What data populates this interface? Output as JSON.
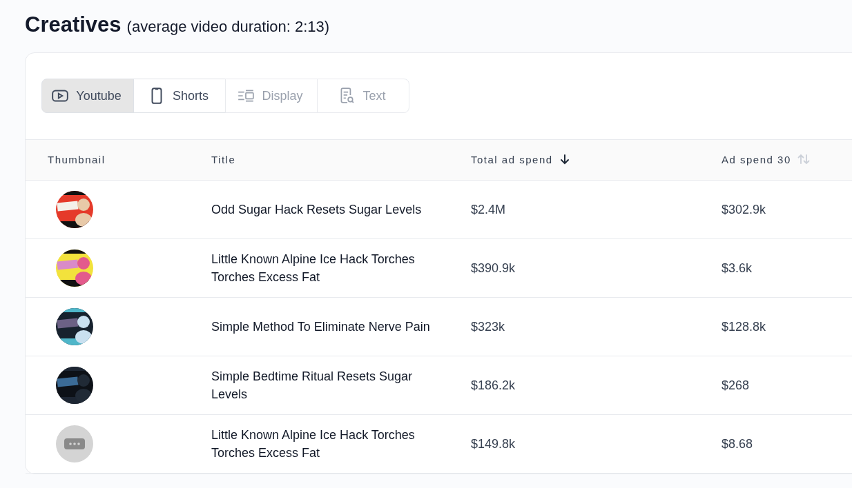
{
  "heading": {
    "title": "Creatives",
    "subtitle": "(average video duration: 2:13)"
  },
  "tabs": [
    {
      "label": "Youtube",
      "kind": "video",
      "selected": true,
      "disabled": false
    },
    {
      "label": "Shorts",
      "kind": "phone",
      "selected": false,
      "disabled": false
    },
    {
      "label": "Display",
      "kind": "display",
      "selected": false,
      "disabled": true
    },
    {
      "label": "Text",
      "kind": "text",
      "selected": false,
      "disabled": true
    }
  ],
  "table": {
    "columns": [
      {
        "label": "Thumbnail",
        "kind": "plain"
      },
      {
        "label": "Title",
        "kind": "plain"
      },
      {
        "label": "Total ad spend",
        "kind": "sorted"
      },
      {
        "label": "Ad spend 30",
        "kind": "sortable"
      }
    ],
    "rows": [
      {
        "title": "Odd Sugar Hack Resets Sugar Levels",
        "total": "$2.4M",
        "spend30": "$302.9k"
      },
      {
        "title": "Little Known Alpine Ice Hack Torches Torches Excess Fat",
        "total": "$390.9k",
        "spend30": "$3.6k"
      },
      {
        "title": "Simple Method To Eliminate Nerve Pain",
        "total": "$323k",
        "spend30": "$128.8k"
      },
      {
        "title": "Simple Bedtime Ritual Resets Sugar Levels",
        "total": "$186.2k",
        "spend30": "$268"
      },
      {
        "thumbnail": {
          "kind": "placeholder"
        },
        "title": "Little Known Alpine Ice Hack Torches Torches Excess Fat",
        "total": "$149.8k",
        "spend30": "$8.68"
      }
    ]
  }
}
